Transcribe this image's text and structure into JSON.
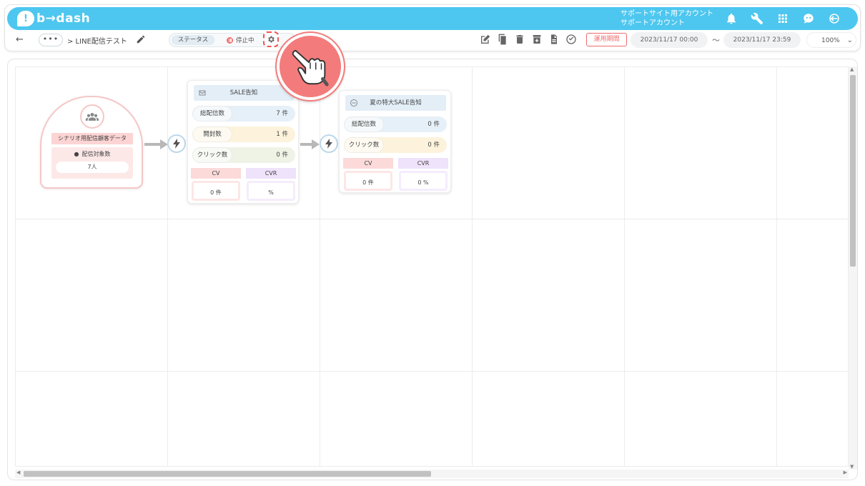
{
  "app": {
    "logo_text": "b→dash",
    "logo_mark": "!"
  },
  "account": {
    "line1": "サポートサイト用アカウント",
    "line2": "サポートアカウント"
  },
  "toolbar": {
    "back_label": "←",
    "more_label": "•••",
    "breadcrumb": "> LINE配信テスト",
    "status_label": "ステータス",
    "status_value": "停止中",
    "period_label": "運用期間",
    "date_start": "2023/11/17 00:00",
    "tilde": "〜",
    "date_end": "2023/11/17 23:59",
    "zoom": "100%",
    "zoom_chev": "⌄"
  },
  "segment_node": {
    "title": "シナリオ用配信顧客データ",
    "count_label": "配信対象数",
    "count_value": "7人"
  },
  "message_node_1": {
    "title": "SALE告知",
    "rows": [
      {
        "label": "総配信数",
        "value": "7 件"
      },
      {
        "label": "開封数",
        "value": "1 件"
      },
      {
        "label": "クリック数",
        "value": "0 件"
      }
    ],
    "cv_label": "CV",
    "cvr_label": "CVR",
    "cv_value": "0 件",
    "cvr_value": "%"
  },
  "message_node_2": {
    "title": "夏の特大SALE告知",
    "rows": [
      {
        "label": "総配信数",
        "value": "0 件"
      },
      {
        "label": "クリック数",
        "value": "0 件"
      }
    ],
    "cv_label": "CV",
    "cvr_label": "CVR",
    "cv_value": "0 件",
    "cvr_value": "0 %"
  },
  "colors": {
    "brand": "#4dc7ef",
    "accent_red": "#ef6b6b",
    "row_blue": "#e6f0f8",
    "row_yellow": "#fdf3dc",
    "row_green": "#eef3e6",
    "cv_pink": "#fcdada",
    "cvr_purple": "#efe2fb"
  }
}
